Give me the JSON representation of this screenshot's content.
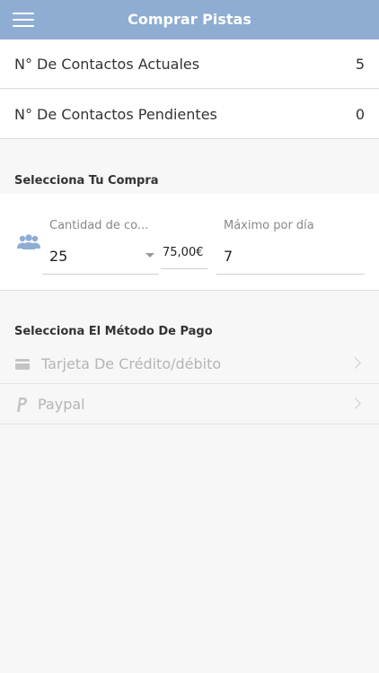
{
  "header": {
    "title": "Comprar Pistas",
    "menu_icon": "hamburger-menu-icon"
  },
  "stats": [
    {
      "label": "N° De Contactos Actuales",
      "value": "5"
    },
    {
      "label": "N° De Contactos Pendientes",
      "value": "0"
    }
  ],
  "purchase": {
    "section_title": "Selecciona Tu Compra",
    "icon": "users-icon",
    "quantity": {
      "label": "Cantidad de co...",
      "value": "25"
    },
    "price": "75,00€",
    "max_per_day": {
      "label": "Máximo por día",
      "value": "7"
    }
  },
  "payment": {
    "section_title": "Selecciona El Método De Pago",
    "methods": [
      {
        "label": "Tarjeta De Crédito/débito",
        "icon": "credit-card-icon"
      },
      {
        "label": "Paypal",
        "icon": "paypal-icon"
      }
    ]
  },
  "colors": {
    "header_bg": "#8fadd2",
    "icon_blue": "#8fadd2",
    "disabled_text": "#b5b5b5"
  }
}
